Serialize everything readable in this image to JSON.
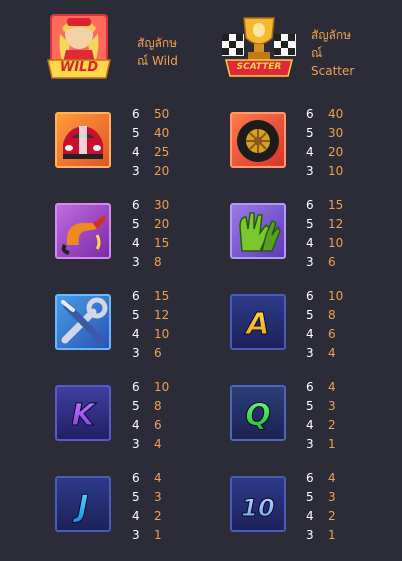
{
  "wild": {
    "label_th": "สัญลักษ",
    "label_th2": "ณ์",
    "label_en": "Wild",
    "badge": "WILD",
    "icon": "race-girl-wild-icon"
  },
  "scatter": {
    "label_th": "สัญลักษ",
    "label_th2": "ณ์",
    "label_en": "Scatter",
    "badge": "SCATTER",
    "icon": "trophy-scatter-icon"
  },
  "symbols": [
    {
      "id": "race-car",
      "icon": "race-car-icon",
      "pays": [
        {
          "count": "6",
          "value": "50"
        },
        {
          "count": "5",
          "value": "40"
        },
        {
          "count": "4",
          "value": "25"
        },
        {
          "count": "3",
          "value": "20"
        }
      ]
    },
    {
      "id": "tire",
      "icon": "tire-icon",
      "pays": [
        {
          "count": "6",
          "value": "40"
        },
        {
          "count": "5",
          "value": "30"
        },
        {
          "count": "4",
          "value": "20"
        },
        {
          "count": "3",
          "value": "10"
        }
      ]
    },
    {
      "id": "fuel-nozzle",
      "icon": "fuel-nozzle-icon",
      "pays": [
        {
          "count": "6",
          "value": "30"
        },
        {
          "count": "5",
          "value": "20"
        },
        {
          "count": "4",
          "value": "15"
        },
        {
          "count": "3",
          "value": "8"
        }
      ]
    },
    {
      "id": "gloves",
      "icon": "racing-gloves-icon",
      "pays": [
        {
          "count": "6",
          "value": "15"
        },
        {
          "count": "5",
          "value": "12"
        },
        {
          "count": "4",
          "value": "10"
        },
        {
          "count": "3",
          "value": "6"
        }
      ]
    },
    {
      "id": "tools",
      "icon": "wrench-screwdriver-icon",
      "pays": [
        {
          "count": "6",
          "value": "15"
        },
        {
          "count": "5",
          "value": "12"
        },
        {
          "count": "4",
          "value": "10"
        },
        {
          "count": "3",
          "value": "6"
        }
      ]
    },
    {
      "id": "A",
      "letter": "A",
      "icon": "letter-a-icon",
      "pays": [
        {
          "count": "6",
          "value": "10"
        },
        {
          "count": "5",
          "value": "8"
        },
        {
          "count": "4",
          "value": "6"
        },
        {
          "count": "3",
          "value": "4"
        }
      ]
    },
    {
      "id": "K",
      "letter": "K",
      "icon": "letter-k-icon",
      "pays": [
        {
          "count": "6",
          "value": "10"
        },
        {
          "count": "5",
          "value": "8"
        },
        {
          "count": "4",
          "value": "6"
        },
        {
          "count": "3",
          "value": "4"
        }
      ]
    },
    {
      "id": "Q",
      "letter": "Q",
      "icon": "letter-q-icon",
      "pays": [
        {
          "count": "6",
          "value": "4"
        },
        {
          "count": "5",
          "value": "3"
        },
        {
          "count": "4",
          "value": "2"
        },
        {
          "count": "3",
          "value": "1"
        }
      ]
    },
    {
      "id": "J",
      "letter": "J",
      "icon": "letter-j-icon",
      "pays": [
        {
          "count": "6",
          "value": "4"
        },
        {
          "count": "5",
          "value": "3"
        },
        {
          "count": "4",
          "value": "2"
        },
        {
          "count": "3",
          "value": "1"
        }
      ]
    },
    {
      "id": "10",
      "letter": "10",
      "icon": "number-10-icon",
      "pays": [
        {
          "count": "6",
          "value": "4"
        },
        {
          "count": "5",
          "value": "3"
        },
        {
          "count": "4",
          "value": "2"
        },
        {
          "count": "3",
          "value": "1"
        }
      ]
    }
  ],
  "colors": {
    "background": "#2b2c37",
    "payout": "#f0a050",
    "count": "#ffffff"
  }
}
